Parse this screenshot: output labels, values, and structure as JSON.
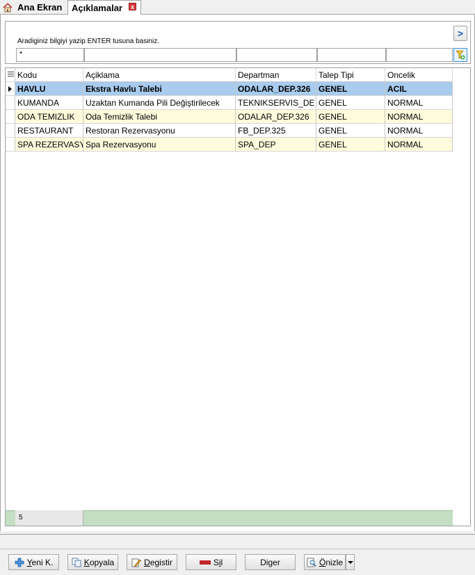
{
  "tabs": [
    {
      "label": "Ana Ekran"
    },
    {
      "label": "Açıklamalar"
    }
  ],
  "tab_close": "x",
  "search": {
    "hint": "Aradiginiz bilgiyi yazip ENTER tusuna basiniz.",
    "filter_values": [
      "*",
      "",
      "",
      "",
      ""
    ],
    "nav_label": ">"
  },
  "grid": {
    "columns": [
      "Kodu",
      "Açiklama",
      "Departman",
      "Talep Tipi",
      "Oncelik"
    ],
    "rows": [
      {
        "kodu": "HAVLU",
        "aciklama": "Ekstra Havlu Talebi",
        "departman": "ODALAR_DEP.326",
        "tip": "GENEL",
        "oncelik": "ACIL"
      },
      {
        "kodu": "KUMANDA",
        "aciklama": "Uzaktan Kumanda Pili Değiştirilecek",
        "departman": "TEKNIKSERVIS_DE",
        "tip": "GENEL",
        "oncelik": "NORMAL"
      },
      {
        "kodu": "ODA TEMIZLIK",
        "aciklama": "Oda Temizlik Talebi",
        "departman": "ODALAR_DEP.326",
        "tip": "GENEL",
        "oncelik": "NORMAL"
      },
      {
        "kodu": "RESTAURANT",
        "aciklama": "Restoran Rezervasyonu",
        "departman": "FB_DEP.325",
        "tip": "GENEL",
        "oncelik": "NORMAL"
      },
      {
        "kodu": "SPA REZERVASYON",
        "aciklama": "Spa Rezervasyonu",
        "departman": "SPA_DEP",
        "tip": "GENEL",
        "oncelik": "NORMAL"
      }
    ],
    "record_count": "5"
  },
  "toolbar": {
    "new_pre": "",
    "new_ul": "Y",
    "new_post": "eni K.",
    "copy_pre": "",
    "copy_ul": "K",
    "copy_post": "opyala",
    "edit_pre": "",
    "edit_ul": "D",
    "edit_post": "egistir",
    "delete_pre": "S",
    "delete_ul": "i",
    "delete_post": "l",
    "other_pre": "Di",
    "other_ul": "g",
    "other_post": "er",
    "preview_pre": "",
    "preview_ul": "Ö",
    "preview_post": "nizle"
  },
  "colors": {
    "selected_row": "#a8cbee",
    "alt_row": "#fffbdc",
    "footer": "#c4dfc4",
    "accent": "#1f5fbf"
  }
}
